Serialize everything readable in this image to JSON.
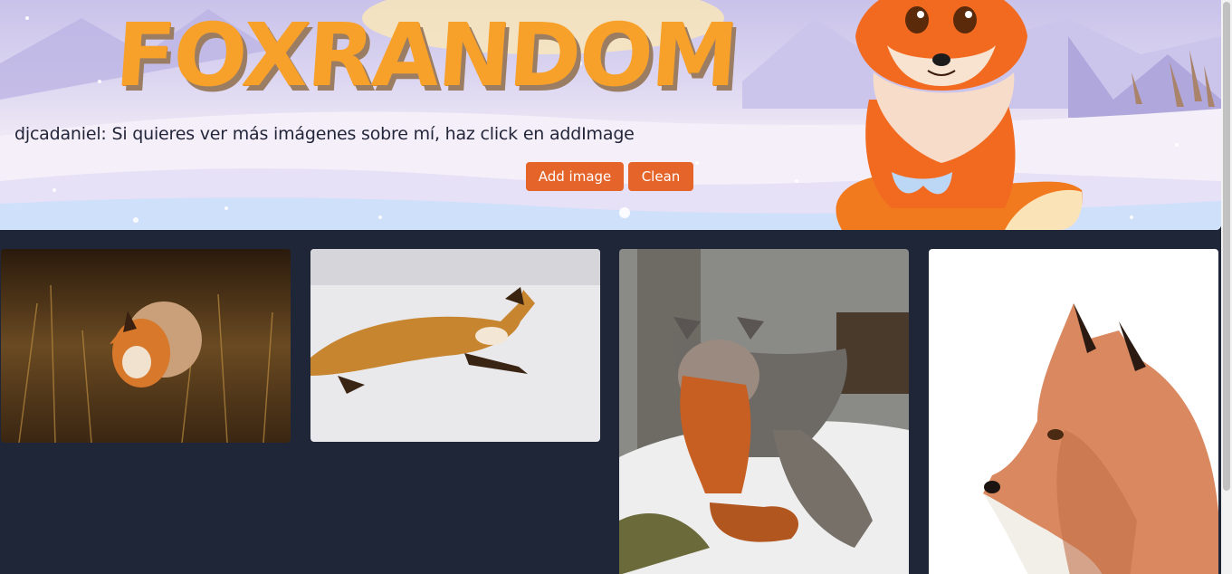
{
  "header": {
    "logo_text": "FOXRANDOM",
    "message": "djcadaniel: Si quieres ver más imágenes sobre mí, haz click en addImage",
    "add_label": "Add image",
    "clean_label": "Clean"
  },
  "gallery": {
    "images": [
      {
        "subject": "red fox crouching in dry grass"
      },
      {
        "subject": "red fox walking through snow"
      },
      {
        "subject": "gray fox sitting in snow"
      },
      {
        "subject": "red fox portrait drawing"
      }
    ]
  },
  "colors": {
    "accent": "#e4642a",
    "page_background": "#1e2637",
    "logo": "#f7a12b"
  }
}
